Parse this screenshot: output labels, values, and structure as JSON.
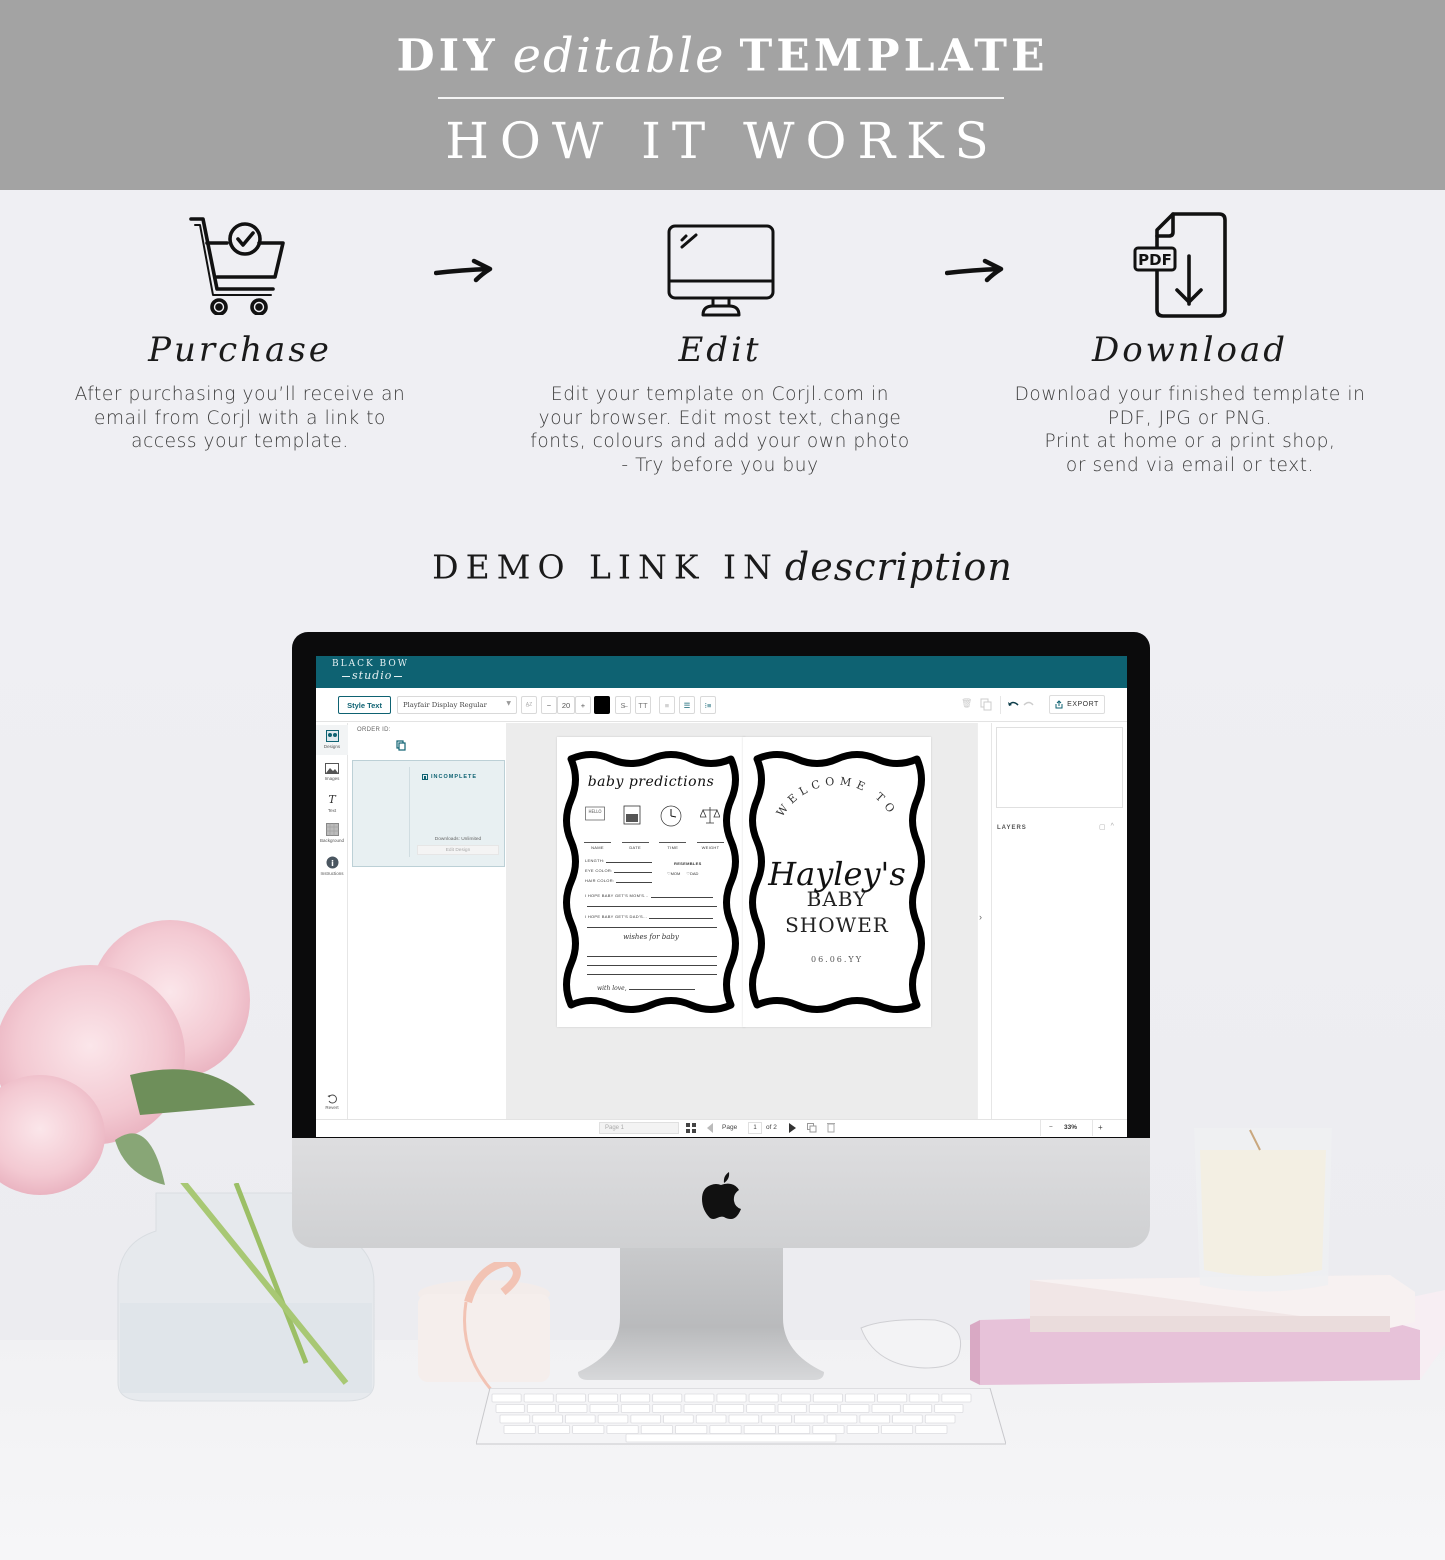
{
  "header": {
    "line1_prefix": "DIY",
    "line1_script": "editable",
    "line1_suffix": "TEMPLATE",
    "line2": "HOW IT WORKS"
  },
  "steps": [
    {
      "icon": "shopping-cart-check-icon",
      "title": "Purchase",
      "description": "After purchasing you’ll receive an email from Corjl with a link to access your template."
    },
    {
      "icon": "desktop-monitor-icon",
      "title": "Edit",
      "description": "Edit your template on Corjl.com in your browser. Edit most text, change fonts, colours and add your own photo - Try before you buy"
    },
    {
      "icon": "pdf-download-icon",
      "title": "Download",
      "description": "Download your finished template in PDF, JPG or PNG. Print at home or a print shop, or send via email or text."
    }
  ],
  "step_lines": [
    [
      "After purchasing you’ll receive an",
      "email from Corjl with a link to",
      "access your template."
    ],
    [
      "Edit your template on Corjl.com in",
      "your browser. Edit most text, change",
      "fonts, colours and add your own photo",
      "- Try before you buy"
    ],
    [
      "Download your finished template in",
      "PDF, JPG or PNG.",
      "Print at home or a print shop,",
      "or send via email or text."
    ]
  ],
  "demo": {
    "caps": "DEMO LINK IN",
    "script": "description"
  },
  "editor": {
    "brand_top": "BLACK BOW",
    "brand_script": "studio",
    "brand_color": "#0e6272",
    "toolbar": {
      "style_text": "Style Text",
      "font_name": "Playfair Display Regular",
      "font_size": "20",
      "minus": "−",
      "plus": "+",
      "text_color": "#000000",
      "uppercase": "TT",
      "export": "EXPORT"
    },
    "rail": [
      {
        "label": "Designs",
        "icon": "designs-icon",
        "active": true
      },
      {
        "label": "Images",
        "icon": "image-icon",
        "active": false
      },
      {
        "label": "Text",
        "icon": "text-icon",
        "active": false
      },
      {
        "label": "Background",
        "icon": "background-pattern-icon",
        "active": false
      },
      {
        "label": "Instructions",
        "icon": "info-icon",
        "active": false
      }
    ],
    "revert_label": "Revert",
    "designs_panel": {
      "order_id_label": "ORDER ID:",
      "status": "INCOMPLETE",
      "downloads": "Downloads: Unlimited",
      "edit_button": "Edit Design"
    },
    "right_panel": {
      "layers_label": "LAYERS"
    },
    "bottom_bar": {
      "page_select": "Page 1",
      "page_label": "Page",
      "current_page": "1",
      "of_pages": "of 2",
      "zoom": "33%",
      "zoom_minus": "−",
      "zoom_plus": "+"
    },
    "page_left": {
      "title": "baby predictions",
      "icon_labels": [
        "NAME",
        "DATE",
        "TIME",
        "WEIGHT"
      ],
      "hello_tag": "HELLO",
      "fields": [
        "LENGTH:",
        "EYE COLOR:",
        "HAIR COLOR:"
      ],
      "resembles": "RESEMBLES",
      "resembles_options": [
        "MOM",
        "DAD"
      ],
      "hope_mom": "I HOPE BABY GET'S MOM'S...",
      "hope_dad": "I HOPE BABY GET'S DAD'S...",
      "wishes": "wishes for baby",
      "signoff": "with love,"
    },
    "page_right": {
      "welcome": "WELCOME TO",
      "name": "Hayley's",
      "line1": "BABY",
      "line2": "SHOWER",
      "date": "06.06.YY"
    }
  }
}
